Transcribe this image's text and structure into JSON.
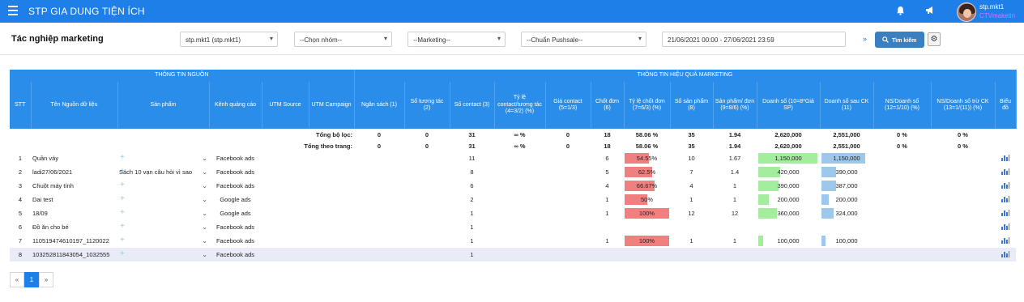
{
  "app": {
    "brand": "STP GIA DUNG TIỆN ÍCH",
    "user": "stp.mkt1",
    "role": "CTVmaketin"
  },
  "page": {
    "title": "Tác nghiệp marketing"
  },
  "filters": {
    "account": "stp.mkt1 (stp.mkt1)",
    "group": "--Chọn nhóm--",
    "marketing": "--Marketing--",
    "pushsale": "--Chuẩn Pushsale--",
    "date_range": "21/06/2021 00:00 - 27/06/2021 23:59",
    "search_label": "Tìm kiếm"
  },
  "table": {
    "group_headers": {
      "source": "THÔNG TIN NGUỒN",
      "marketing": "THÔNG TIN HIỆU QUẢ MARKETING"
    },
    "columns": {
      "stt": "STT",
      "source_name": "Tên Nguồn dữ liệu",
      "product": "Sản phẩm",
      "channel": "Kênh quảng cáo",
      "utm_source": "UTM Source",
      "utm_campaign": "UTM Campaign",
      "budget": "Ngân sách (1)",
      "interactions": "Số tương tác (2)",
      "contacts": "Số contact (3)",
      "contact_rate": "Tỷ lệ contact/tương tác (4=3/2) (%)",
      "contact_price": "Giá contact (5=1/3)",
      "closed": "Chốt đơn (6)",
      "close_rate": "Tỷ lệ chốt đơn (7=6/3) (%)",
      "products_count": "Số sản phẩm (8)",
      "products_per_order": "Sản phẩm/ đơn (9=8/6) (%)",
      "revenue": "Doanh số (10=8*Giá SP)",
      "revenue_after": "Doanh số sau CK (11)",
      "ns_revenue": "NS/Doanh số (12=1/10) (%)",
      "ns_revenue_after": "NS/Doanh số trừ CK (13=1/(11)) (%)",
      "chart": "Biểu đồ"
    },
    "summary": [
      {
        "label": "Tổng bộ lọc:",
        "budget": "0",
        "interactions": "0",
        "contacts": "31",
        "contact_rate": "∞ %",
        "contact_price": "0",
        "closed": "18",
        "close_rate": "58.06 %",
        "products_count": "35",
        "products_per_order": "1.94",
        "revenue": "2,620,000",
        "revenue_after": "2,551,000",
        "ns_revenue": "0 %",
        "ns_revenue_after": "0 %"
      },
      {
        "label": "Tổng theo trang:",
        "budget": "0",
        "interactions": "0",
        "contacts": "31",
        "contact_rate": "∞ %",
        "contact_price": "0",
        "closed": "18",
        "close_rate": "58.06 %",
        "products_count": "35",
        "products_per_order": "1.94",
        "revenue": "2,620,000",
        "revenue_after": "2,551,000",
        "ns_revenue": "0 %",
        "ns_revenue_after": "0 %"
      }
    ],
    "rows": [
      {
        "stt": "1",
        "source_name": "Quần váy",
        "product": "",
        "channel": "Facebook ads",
        "contacts": "11",
        "closed": "6",
        "close_rate": "54.55%",
        "close_rate_value": 54.55,
        "products_count": "10",
        "products_per_order": "1.67",
        "revenue": "1,150,000",
        "revenue_value": 1150000,
        "revenue_after": "1,150,000",
        "revenue_after_value": 1150000
      },
      {
        "stt": "2",
        "source_name": "ladi27/06/2021",
        "product": "Sách 10 vạn câu hỏi vì sao",
        "channel": "Facebook ads",
        "contacts": "8",
        "closed": "5",
        "close_rate": "62.5%",
        "close_rate_value": 62.5,
        "products_count": "7",
        "products_per_order": "1.4",
        "revenue": "420,000",
        "revenue_value": 420000,
        "revenue_after": "390,000",
        "revenue_after_value": 390000
      },
      {
        "stt": "3",
        "source_name": "Chuột máy tính",
        "product": "",
        "channel": "Facebook ads",
        "contacts": "6",
        "closed": "4",
        "close_rate": "66.67%",
        "close_rate_value": 66.67,
        "products_count": "4",
        "products_per_order": "1",
        "revenue": "390,000",
        "revenue_value": 390000,
        "revenue_after": "387,000",
        "revenue_after_value": 387000
      },
      {
        "stt": "4",
        "source_name": "Dai test",
        "product": "",
        "channel": "Google ads",
        "contacts": "2",
        "closed": "1",
        "close_rate": "50%",
        "close_rate_value": 50,
        "products_count": "1",
        "products_per_order": "1",
        "revenue": "200,000",
        "revenue_value": 200000,
        "revenue_after": "200,000",
        "revenue_after_value": 200000
      },
      {
        "stt": "5",
        "source_name": "18/09",
        "product": "",
        "channel": "Google ads",
        "contacts": "1",
        "closed": "1",
        "close_rate": "100%",
        "close_rate_value": 100,
        "products_count": "12",
        "products_per_order": "12",
        "revenue": "360,000",
        "revenue_value": 360000,
        "revenue_after": "324,000",
        "revenue_after_value": 324000
      },
      {
        "stt": "6",
        "source_name": "Đồ ăn cho bé",
        "product": "",
        "channel": "Facebook ads",
        "contacts": "1",
        "closed": "",
        "close_rate": "",
        "close_rate_value": 0,
        "products_count": "",
        "products_per_order": "",
        "revenue": "",
        "revenue_value": 0,
        "revenue_after": "",
        "revenue_after_value": 0
      },
      {
        "stt": "7",
        "source_name": "110519474610197_1120022",
        "product": "",
        "channel": "Facebook ads",
        "contacts": "1",
        "closed": "1",
        "close_rate": "100%",
        "close_rate_value": 100,
        "products_count": "1",
        "products_per_order": "1",
        "revenue": "100,000",
        "revenue_value": 100000,
        "revenue_after": "100,000",
        "revenue_after_value": 100000
      },
      {
        "stt": "8",
        "source_name": "103252811843054_1032555",
        "product": "",
        "channel": "Facebook ads",
        "contacts": "1",
        "closed": "",
        "close_rate": "",
        "close_rate_value": 0,
        "products_count": "",
        "products_per_order": "",
        "revenue": "",
        "revenue_value": 0,
        "revenue_after": "",
        "revenue_after_value": 0
      }
    ]
  },
  "pagination": {
    "prev": "«",
    "page": "1",
    "next": "»"
  },
  "icons": {
    "menu": "menu-icon",
    "bell": "bell-icon",
    "announce": "megaphone-icon",
    "search": "search-icon",
    "settings": "gear-icon",
    "chart": "bar-chart-icon",
    "expand": "double-chevron-down-icon",
    "add": "plus-icon"
  },
  "colors": {
    "primary": "#1e7fe8",
    "header": "#2a8dea",
    "close_rate_bar": "#f08080",
    "revenue_bar": "#a4ec9e",
    "revenue_after_bar": "#9ec7ec",
    "role": "#e36cff"
  }
}
